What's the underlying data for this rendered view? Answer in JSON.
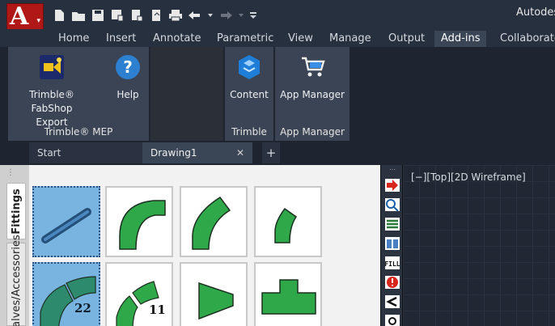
{
  "app": {
    "logo_letter": "A",
    "title": "Autodes"
  },
  "ribbon_tabs": [
    "Home",
    "Insert",
    "Annotate",
    "Parametric",
    "View",
    "Manage",
    "Output",
    "Add-ins",
    "Collaborate"
  ],
  "active_tab": "Add-ins",
  "panels": {
    "trimble_mep": {
      "title": "Trimble® MEP",
      "fabshop_label_1": "Trimble® FabShop",
      "fabshop_label_2": "Export",
      "help_label": "Help"
    },
    "trimble": {
      "title": "Trimble",
      "content_label": "Content"
    },
    "app_manager": {
      "title": "App Manager",
      "app_manager_label": "App Manager"
    }
  },
  "doc_tabs": {
    "start": "Start",
    "drawing": "Drawing1",
    "close_glyph": "✕",
    "add_glyph": "+"
  },
  "palette": {
    "tab_fittings": "Fittings",
    "tab_accessories": "Valves/Accessories",
    "tile_badges": [
      "22",
      "11"
    ]
  },
  "toolstrip": {
    "fill_label": "FILL"
  },
  "viewport": {
    "label": "[−][Top][2D Wireframe]"
  },
  "colors": {
    "accent_red": "#b01818",
    "fitting_green": "#2fa84a",
    "selection_blue": "#79b4e0"
  }
}
